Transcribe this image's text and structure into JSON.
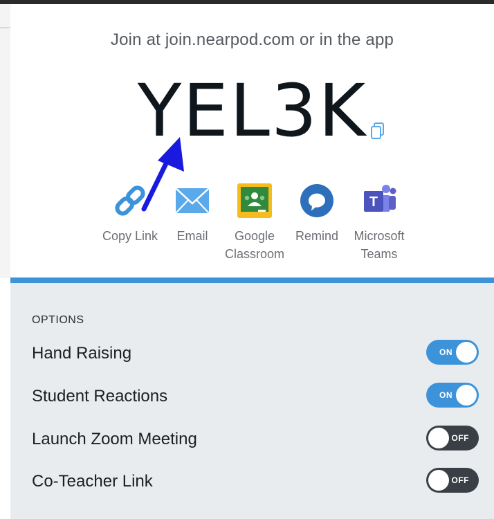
{
  "header": {
    "join_text": "Join at join.nearpod.com or in the app",
    "code": "YEL3K"
  },
  "share": [
    {
      "icon": "link-icon",
      "label": "Copy Link",
      "color": "#3d93d9"
    },
    {
      "icon": "email-icon",
      "label": "Email",
      "color": "#5aa9ea"
    },
    {
      "icon": "google-classroom-icon",
      "label": "Google Classroom",
      "color": "#2f8a3b"
    },
    {
      "icon": "remind-icon",
      "label": "Remind",
      "color": "#2d6fba"
    },
    {
      "icon": "microsoft-teams-icon",
      "label": "Microsoft Teams",
      "color": "#5b5fc7"
    }
  ],
  "options": {
    "heading": "OPTIONS",
    "items": [
      {
        "label": "Hand Raising",
        "state": "ON"
      },
      {
        "label": "Student Reactions",
        "state": "ON"
      },
      {
        "label": "Launch Zoom Meeting",
        "state": "OFF"
      },
      {
        "label": "Co-Teacher Link",
        "state": "OFF"
      }
    ]
  },
  "colors": {
    "accent": "#3d93d9",
    "toggle_off": "#3a3f45",
    "options_bg": "#e9ecef",
    "annotation_arrow": "#1a1adf"
  }
}
